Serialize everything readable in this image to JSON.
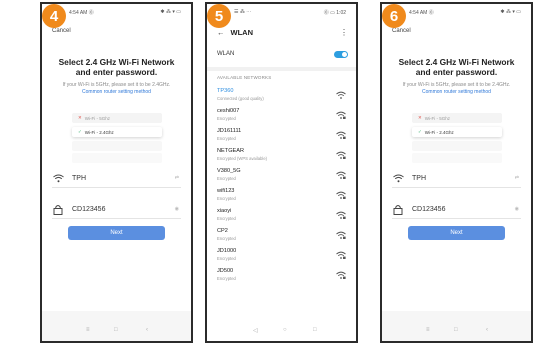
{
  "steps": [
    "4",
    "5",
    "6"
  ],
  "setup": {
    "cancel": "Cancel",
    "title": "Select 2.4 GHz Wi-Fi Network and enter password.",
    "subtitle": "If your Wi-Fi is 5GHz, please set it to be 2.4GHz.",
    "link": "Common router setting method",
    "illus_row1": "Wi-Fi - 5Ghz",
    "illus_row2": "Wi-Fi - 2.4Ghz",
    "wifi_name": "TPH",
    "password": "CD123456",
    "next_label": "Next"
  },
  "wlan": {
    "title": "WLAN",
    "toggle_label": "WLAN",
    "toggle_on": true,
    "available_header": "AVAILABLE NETWORKS",
    "networks": [
      {
        "name": "TP360",
        "status": "Connected (good quality)"
      },
      {
        "name": "ceshi007",
        "status": "Encrypted"
      },
      {
        "name": "JD161111",
        "status": "Encrypted"
      },
      {
        "name": "NETGEAR",
        "status": "Encrypted (WPS available)"
      },
      {
        "name": "V380_5G",
        "status": "Encrypted"
      },
      {
        "name": "wifi123",
        "status": "Encrypted"
      },
      {
        "name": "xiaoyi",
        "status": "Encrypted"
      },
      {
        "name": "CP2",
        "status": "Encrypted"
      },
      {
        "name": "JD1000",
        "status": "Encrypted"
      },
      {
        "name": "JD500",
        "status": "Encrypted"
      }
    ]
  },
  "colors": {
    "step_badge": "#f08a1c",
    "next_button": "#5b8fe0",
    "toggle": "#2d9ee0",
    "link": "#2f78d8"
  }
}
